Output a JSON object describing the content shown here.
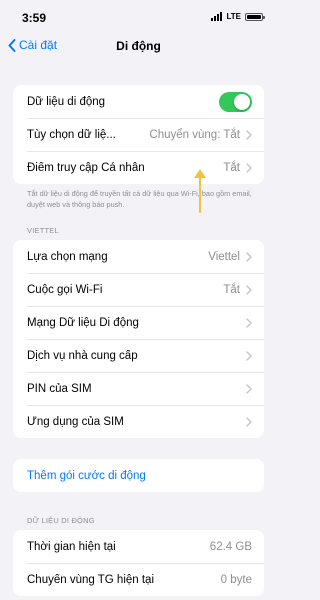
{
  "status": {
    "time": "3:59",
    "network": "LTE"
  },
  "nav": {
    "back_label": "Cài đặt",
    "title": "Di động"
  },
  "group1": {
    "mobile_data_label": "Dữ liệu di động",
    "mobile_data_on": true,
    "options_label": "Tùy chọn dữ liệ...",
    "options_value": "Chuyển vùng: Tắt",
    "hotspot_label": "Điểm truy cập Cá nhân",
    "hotspot_value": "Tắt"
  },
  "footnote_1": "Tắt dữ liệu di động để truyền tất cả dữ liệu qua Wi-Fi, bao gồm email, duyệt web và thông báo push.",
  "carrier_section": {
    "header": "VIETTEL",
    "items": [
      {
        "label": "Lựa chọn mạng",
        "value": "Viettel"
      },
      {
        "label": "Cuộc gọi Wi-Fi",
        "value": "Tắt"
      },
      {
        "label": "Mạng Dữ liệu Di động",
        "value": ""
      },
      {
        "label": "Dịch vụ nhà cung cấp",
        "value": ""
      },
      {
        "label": "PIN của SIM",
        "value": ""
      },
      {
        "label": "Ứng dụng của SIM",
        "value": ""
      }
    ]
  },
  "add_plan_label": "Thêm gói cước di động",
  "usage_section": {
    "header": "DỮ LIỆU DI ĐỘNG",
    "items": [
      {
        "label": "Thời gian hiện tại",
        "value": "62.4 GB"
      },
      {
        "label": "Chuyển vùng TG hiện tại",
        "value": "0 byte"
      }
    ]
  },
  "colors": {
    "accent": "#007aff",
    "toggle_on": "#34c759",
    "annotation_arrow": "#f5c040"
  }
}
